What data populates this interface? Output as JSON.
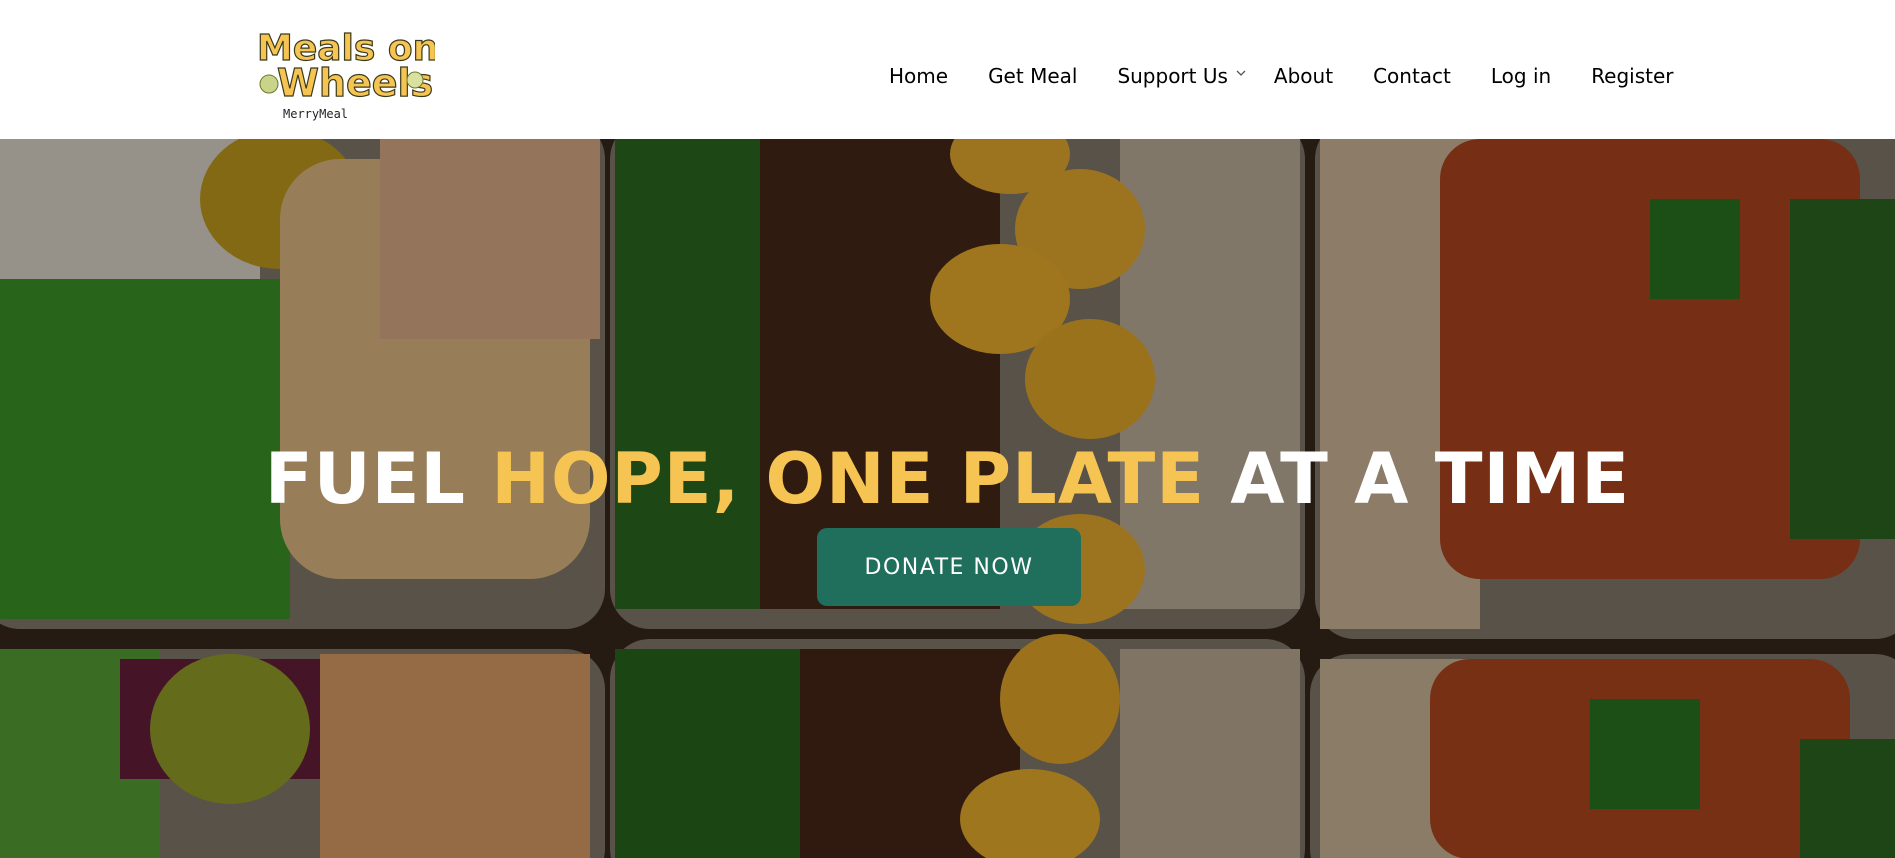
{
  "brand": {
    "logo_line1": "Meals on",
    "logo_line2": "Wheels",
    "logo_tagline": "MerryMeal",
    "logo_color": "#f6c452"
  },
  "nav": {
    "items": [
      {
        "label": "Home"
      },
      {
        "label": "Get Meal"
      },
      {
        "label": "Support Us",
        "icon": "chevron-down-icon"
      },
      {
        "label": "About"
      },
      {
        "label": "Contact"
      },
      {
        "label": "Log in"
      },
      {
        "label": "Register"
      }
    ]
  },
  "hero": {
    "title_part1": "FUEL ",
    "title_accent": "HOPE, ONE PLATE",
    "title_part2": " AT A TIME",
    "accent_color": "#f6c452",
    "cta_label": "DONATE NOW",
    "cta_color": "#1f6f5c",
    "background": "meal-prep-containers-photo"
  }
}
